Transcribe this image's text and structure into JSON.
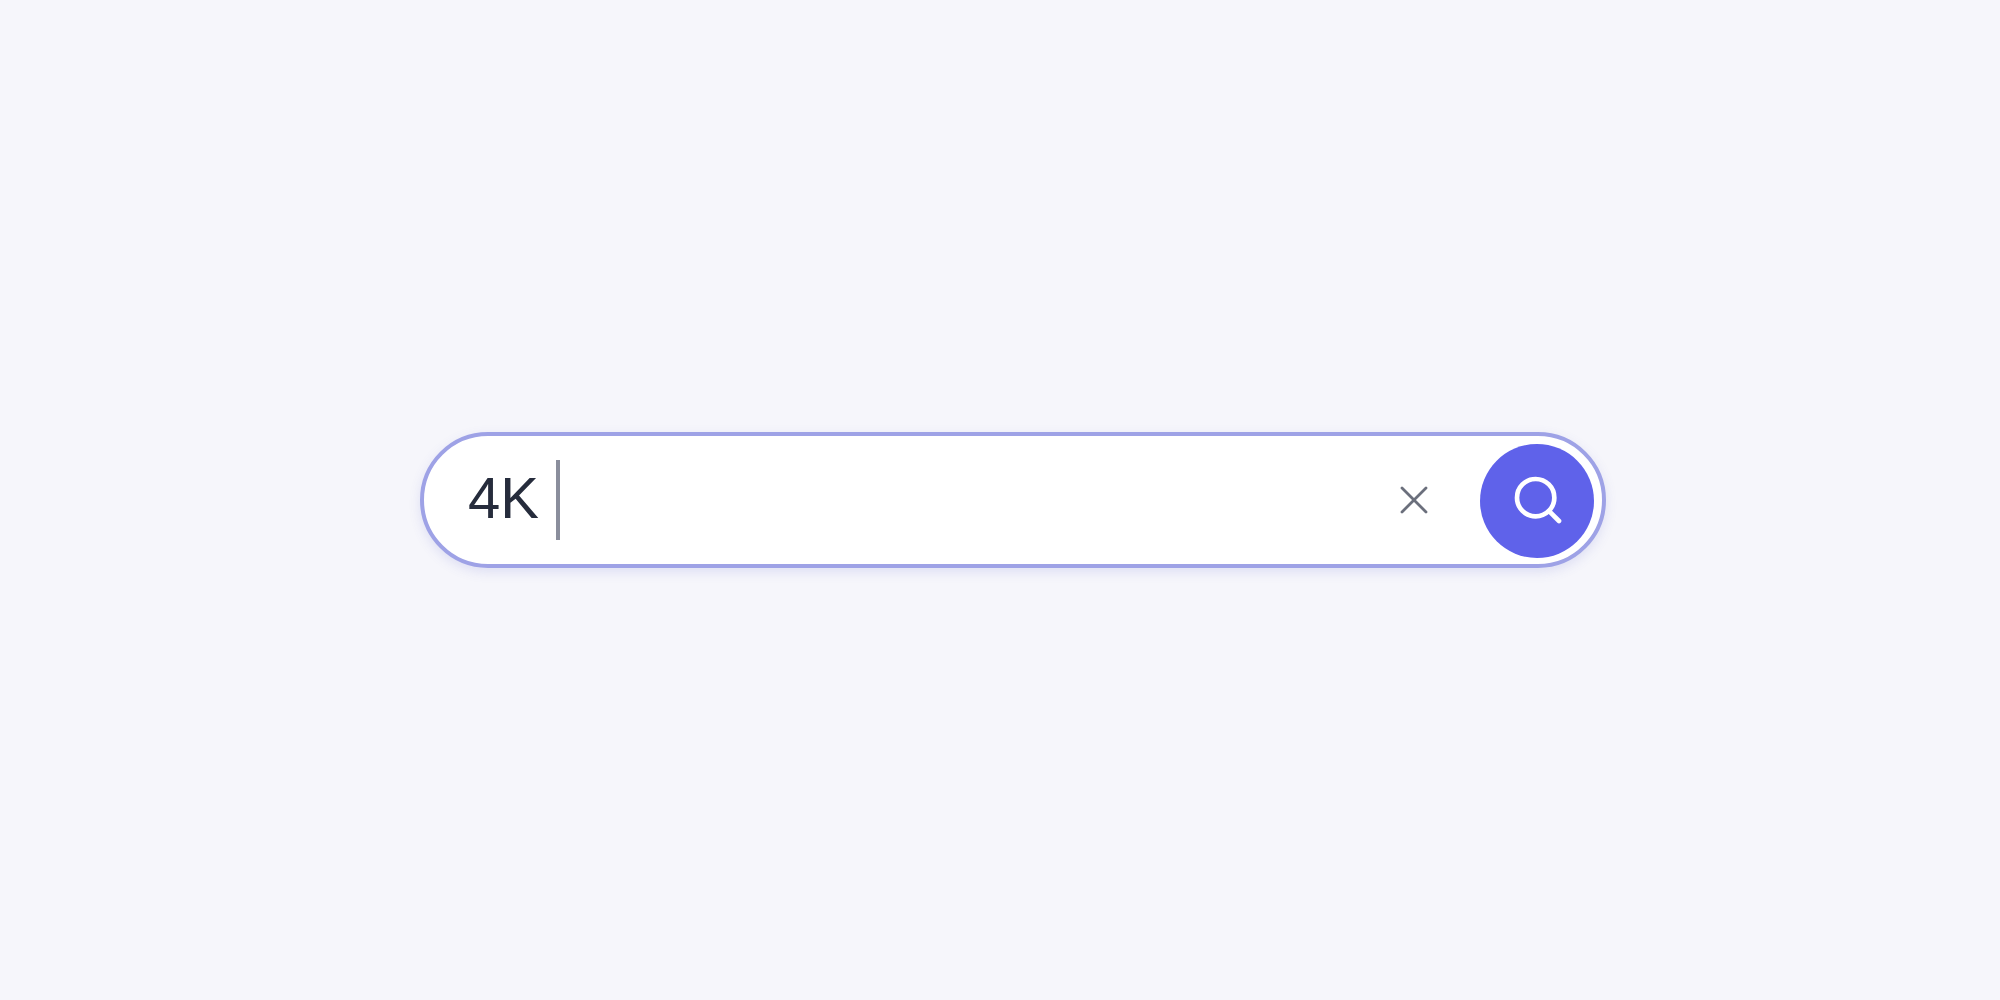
{
  "search": {
    "value": "4K",
    "focused": true
  }
}
